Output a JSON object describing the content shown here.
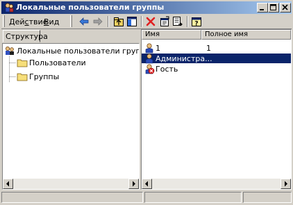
{
  "window": {
    "title": "Локальные пользователи группы",
    "controls": [
      "minimize-icon",
      "maximize-icon",
      "close-icon"
    ]
  },
  "menu": {
    "action_pre": "Дей",
    "action_ul": "с",
    "action_post": "твие",
    "view_ul": "В",
    "view_post": "ид"
  },
  "toolbar": {
    "icons": [
      "back-arrow-icon",
      "forward-arrow-icon",
      "up-level-icon",
      "show-hide-tree-icon",
      "delete-icon",
      "properties-icon",
      "export-list-icon",
      "help-icon"
    ]
  },
  "left_pane": {
    "tab_label": "Структура",
    "tree": {
      "root": "Локальные пользователи группы (лок",
      "children": [
        "Пользователи",
        "Группы"
      ]
    }
  },
  "right_pane": {
    "columns": [
      "Имя",
      "Полное имя"
    ],
    "rows": [
      {
        "name": "1",
        "full_name": "1",
        "icon": "user-icon",
        "selected": false
      },
      {
        "name": "Администра...",
        "full_name": "",
        "icon": "user-icon",
        "selected": true
      },
      {
        "name": "Гость",
        "full_name": "",
        "icon": "disabled-user-icon",
        "selected": false
      }
    ]
  },
  "colors": {
    "title_bar": "#0a246a",
    "selection": "#0a246a",
    "face": "#d4d0c8"
  }
}
